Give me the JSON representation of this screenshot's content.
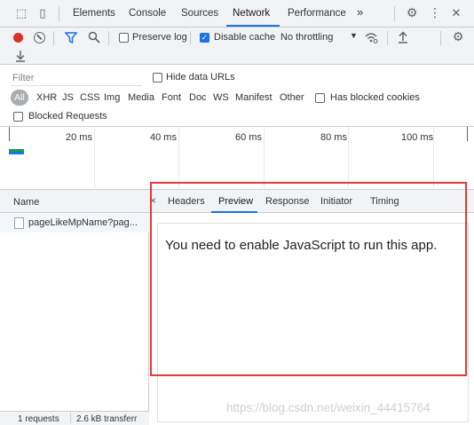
{
  "tabbar": {
    "tabs": [
      "Elements",
      "Console",
      "Sources",
      "Network",
      "Performance"
    ],
    "more": "»",
    "gear": "⚙",
    "kebab": "⋮",
    "close": "✕"
  },
  "toolbar": {
    "preserve_log": "Preserve log",
    "disable_cache": "Disable cache",
    "disable_cache_checked": true,
    "throttling": "No throttling"
  },
  "filter": {
    "placeholder": "Filter",
    "hide_data_urls": "Hide data URLs",
    "types": [
      "All",
      "XHR",
      "JS",
      "CSS",
      "Img",
      "Media",
      "Font",
      "Doc",
      "WS",
      "Manifest",
      "Other"
    ],
    "has_blocked_cookies": "Has blocked cookies",
    "blocked_requests": "Blocked Requests"
  },
  "overview": {
    "ticks": [
      "20 ms",
      "40 ms",
      "60 ms",
      "80 ms",
      "100 ms"
    ]
  },
  "requests": {
    "header": "Name",
    "items": [
      "pageLikeMpName?pag..."
    ],
    "status_requests": "1 requests",
    "status_transferred": "2.6 kB transferr"
  },
  "detail": {
    "tabs": [
      "Headers",
      "Preview",
      "Response",
      "Initiator",
      "Timing"
    ],
    "active_tab": "Preview",
    "preview_text": "You need to enable JavaScript to run this app."
  },
  "watermark": "https://blog.csdn.net/weixin_44415764",
  "colors": {
    "accent": "#1a73e8",
    "record": "#d93025",
    "highlight": "#e53935"
  }
}
